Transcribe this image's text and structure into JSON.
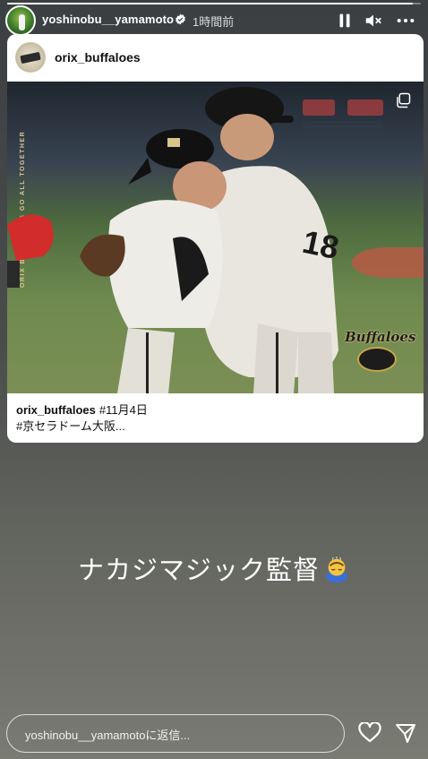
{
  "story": {
    "progress": 0.98,
    "username": "yoshinobu__yamamoto",
    "time_ago": "1時間前",
    "verified": true,
    "controls": [
      "pause-icon",
      "mute-icon",
      "more-icon"
    ]
  },
  "post": {
    "username": "orix_buffaloes",
    "photo_side_text": "ORIX BUFFALOES  GO ALL TOGETHER",
    "logo_text": "Buffaloes",
    "caption_user": "orix_buffaloes",
    "caption_tag": "#11月4日",
    "caption_line2": "#京セラドーム大阪..."
  },
  "overlay": {
    "text": "ナカジマジック監督",
    "emoji": "bowing-person-emoji"
  },
  "reply_bar": {
    "placeholder": "yoshinobu__yamamotoに返信..."
  },
  "colors": {
    "background_top": "#3c3f42",
    "background_bottom": "#7a7b73",
    "card": "#ffffff"
  }
}
